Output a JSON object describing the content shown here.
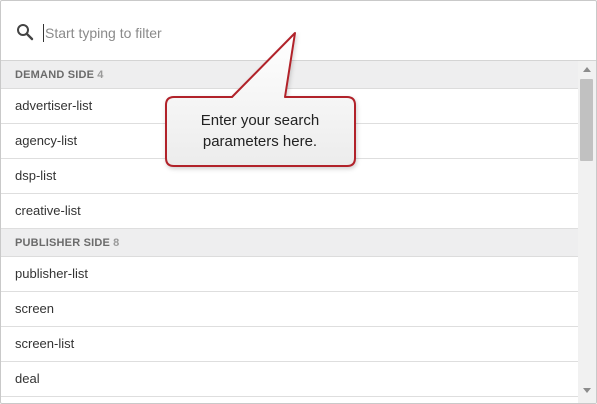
{
  "search": {
    "placeholder": "Start typing to filter",
    "value": ""
  },
  "groups": [
    {
      "label": "DEMAND SIDE",
      "count": "4",
      "items": [
        "advertiser-list",
        "agency-list",
        "dsp-list",
        "creative-list"
      ]
    },
    {
      "label": "PUBLISHER SIDE",
      "count": "8",
      "items": [
        "publisher-list",
        "screen",
        "screen-list",
        "deal"
      ]
    }
  ],
  "callout": {
    "line1": "Enter your search",
    "line2": "parameters here."
  },
  "colors": {
    "callout_border": "#b1242a",
    "group_header_bg": "#eeeeef"
  }
}
